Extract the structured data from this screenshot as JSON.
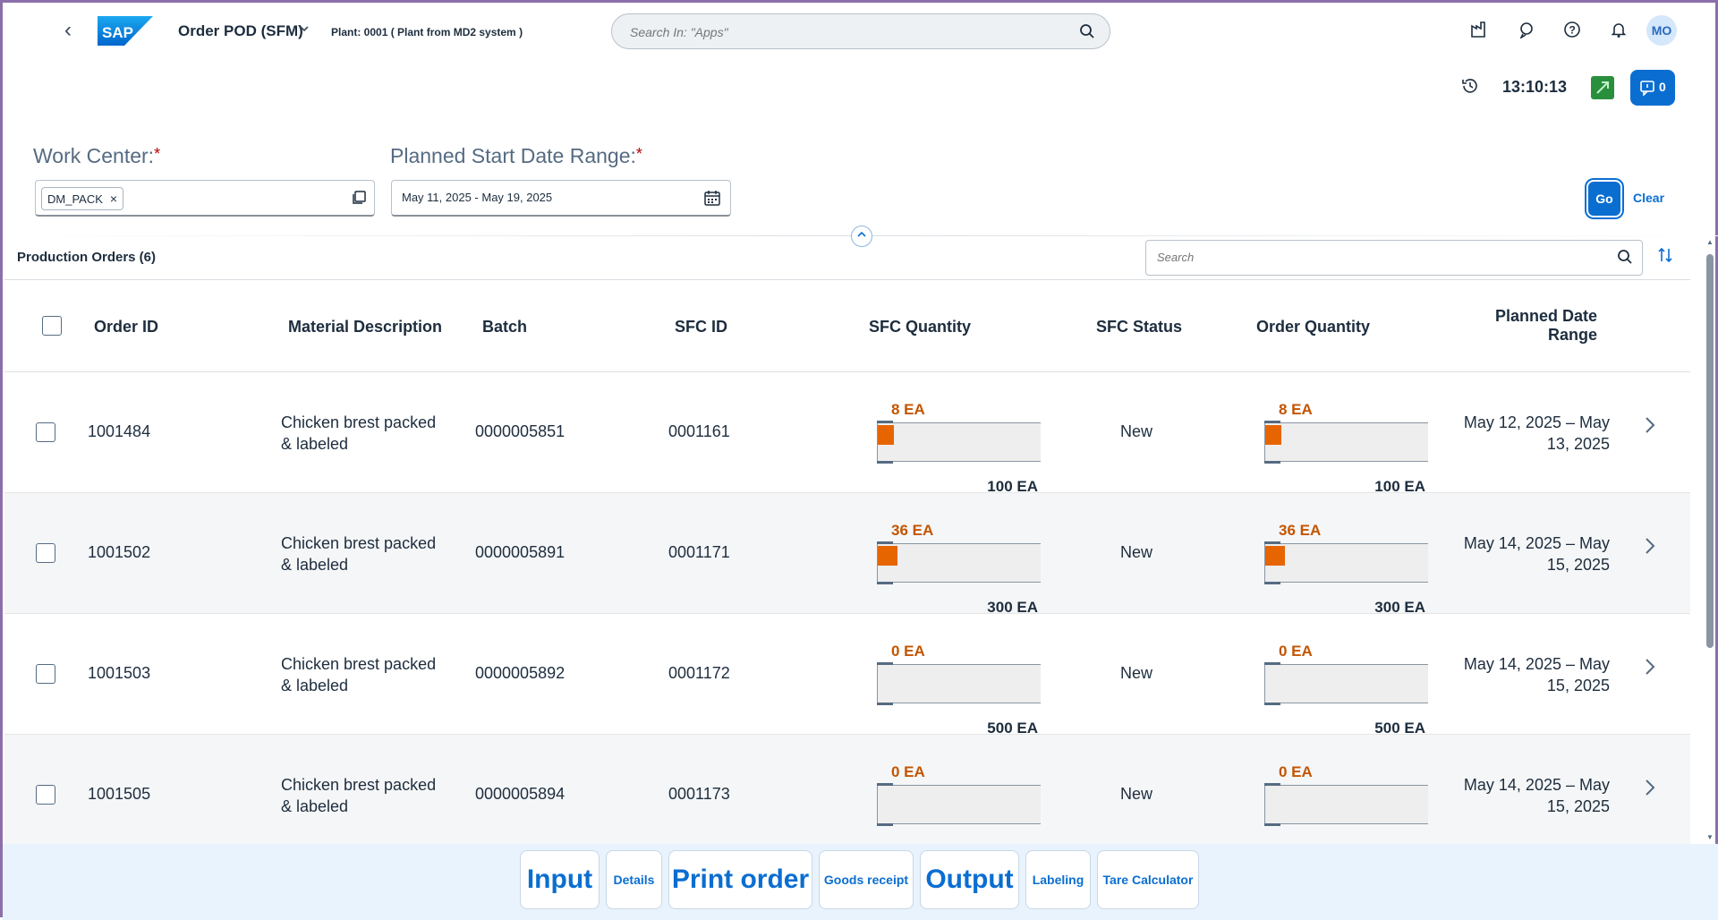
{
  "shell": {
    "app_title": "Order POD (SFM)",
    "plant": "Plant: 0001 ( Plant from MD2 system )",
    "search_placeholder": "Search In: \"Apps\"",
    "avatar_initials": "MO",
    "time": "13:10:13",
    "message_count": "0",
    "logo_text": "SAP"
  },
  "filters": {
    "work_center_label": "Work Center:",
    "work_center_token": "DM_PACK",
    "date_range_label": "Planned Start Date Range:",
    "date_range_value": "May 11, 2025 - May 19, 2025",
    "required_marker": "*",
    "go_label": "Go",
    "clear_label": "Clear"
  },
  "table": {
    "title": "Production Orders (6)",
    "search_placeholder": "Search",
    "columns": {
      "order_id": "Order ID",
      "material": "Material Description",
      "batch": "Batch",
      "sfc_id": "SFC ID",
      "sfc_qty": "SFC Quantity",
      "sfc_status": "SFC Status",
      "order_qty": "Order Quantity",
      "planned_date_1": "Planned Date",
      "planned_date_2": "Range"
    },
    "rows": [
      {
        "order_id": "1001484",
        "material_1": "Chicken brest packed",
        "material_2": "& labeled",
        "batch": "0000005851",
        "sfc_id": "0001161",
        "sfc_qty": "8 EA",
        "sfc_total": "100 EA",
        "sfc_fraction": 0.08,
        "status": "New",
        "order_qty": "8 EA",
        "order_total": "100 EA",
        "order_fraction": 0.08,
        "date_1": "May 12, 2025 – May",
        "date_2": "13, 2025"
      },
      {
        "order_id": "1001502",
        "material_1": "Chicken brest packed",
        "material_2": "& labeled",
        "batch": "0000005891",
        "sfc_id": "0001171",
        "sfc_qty": "36 EA",
        "sfc_total": "300 EA",
        "sfc_fraction": 0.12,
        "status": "New",
        "order_qty": "36 EA",
        "order_total": "300 EA",
        "order_fraction": 0.12,
        "date_1": "May 14, 2025 – May",
        "date_2": "15, 2025"
      },
      {
        "order_id": "1001503",
        "material_1": "Chicken brest packed",
        "material_2": "& labeled",
        "batch": "0000005892",
        "sfc_id": "0001172",
        "sfc_qty": "0 EA",
        "sfc_total": "500 EA",
        "sfc_fraction": 0,
        "status": "New",
        "order_qty": "0 EA",
        "order_total": "500 EA",
        "order_fraction": 0,
        "date_1": "May 14, 2025 – May",
        "date_2": "15, 2025"
      },
      {
        "order_id": "1001505",
        "material_1": "Chicken brest packed",
        "material_2": "& labeled",
        "batch": "0000005894",
        "sfc_id": "0001173",
        "sfc_qty": "0 EA",
        "sfc_total": "",
        "sfc_fraction": 0,
        "status": "New",
        "order_qty": "0 EA",
        "order_total": "",
        "order_fraction": 0,
        "date_1": "May 14, 2025 – May",
        "date_2": "15, 2025"
      }
    ]
  },
  "footer": {
    "input": "Input",
    "details": "Details",
    "print_order": "Print order",
    "goods_receipt": "Goods receipt",
    "output": "Output",
    "labeling": "Labeling",
    "tare_calculator": "Tare Calculator"
  },
  "colors": {
    "accent": "#0a6ed1",
    "progress_fill": "#e76500",
    "progress_text": "#c35500",
    "frame": "#8b6fa9"
  }
}
